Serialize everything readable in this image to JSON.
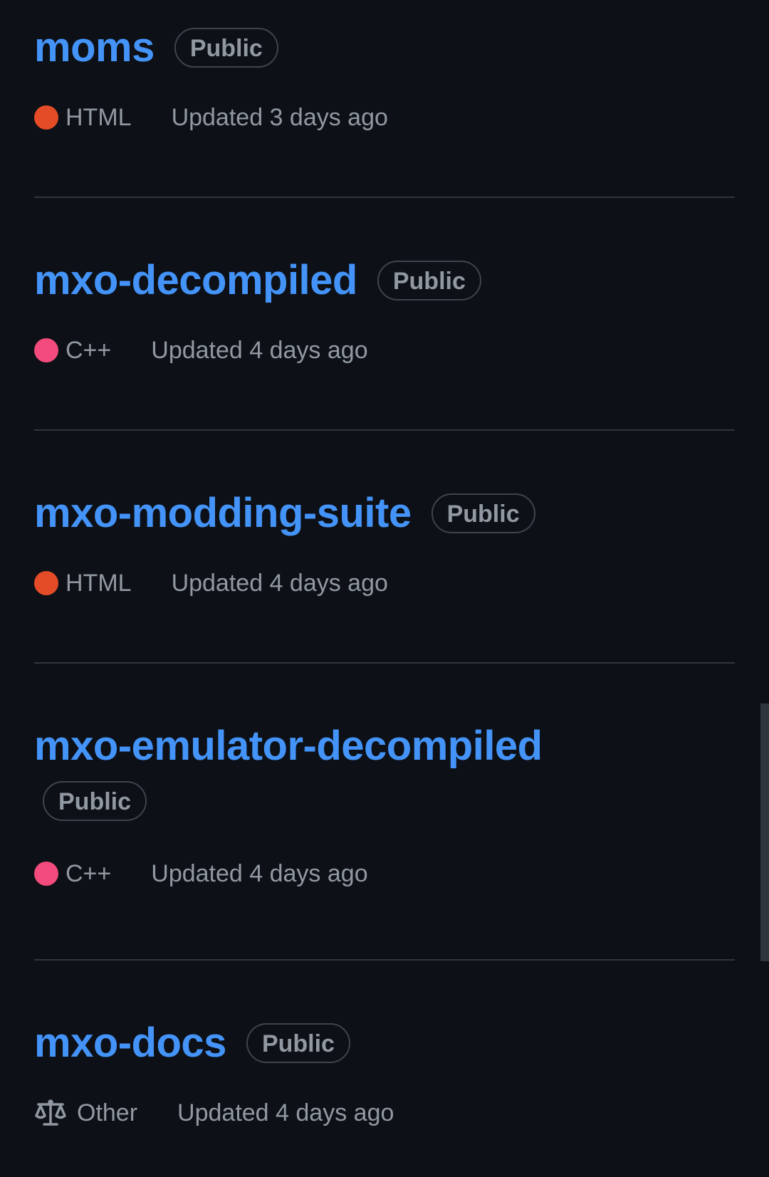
{
  "repositories": [
    {
      "name": "moms",
      "visibility": "Public",
      "language": "HTML",
      "language_color": "#e34c26",
      "updated": "Updated 3 days ago"
    },
    {
      "name": "mxo-decompiled",
      "visibility": "Public",
      "language": "C++",
      "language_color": "#f34b7d",
      "updated": "Updated 4 days ago"
    },
    {
      "name": "mxo-modding-suite",
      "visibility": "Public",
      "language": "HTML",
      "language_color": "#e34c26",
      "updated": "Updated 4 days ago"
    },
    {
      "name": "mxo-emulator-decompiled",
      "visibility": "Public",
      "language": "C++",
      "language_color": "#f34b7d",
      "updated": "Updated 4 days ago"
    },
    {
      "name": "mxo-docs",
      "visibility": "Public",
      "license": "Other",
      "license_icon": "law-scale-icon",
      "updated": "Updated 4 days ago"
    }
  ]
}
